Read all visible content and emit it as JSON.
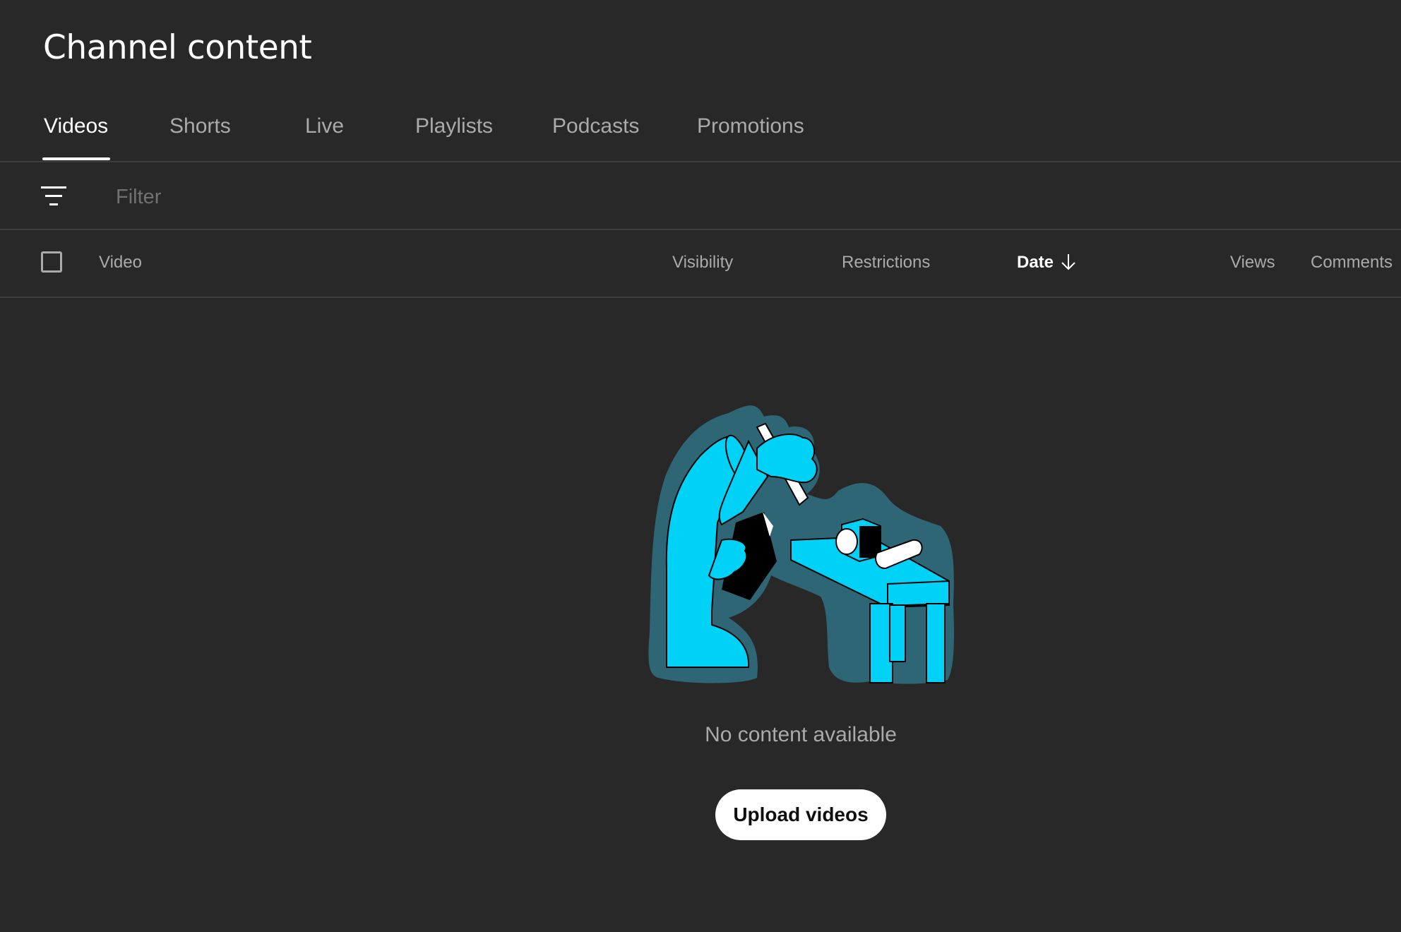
{
  "page": {
    "title": "Channel content"
  },
  "tabs": [
    {
      "label": "Videos",
      "active": true
    },
    {
      "label": "Shorts",
      "active": false
    },
    {
      "label": "Live",
      "active": false
    },
    {
      "label": "Playlists",
      "active": false
    },
    {
      "label": "Podcasts",
      "active": false
    },
    {
      "label": "Promotions",
      "active": false
    }
  ],
  "filter": {
    "placeholder": "Filter",
    "value": "",
    "icon": "filter-lines-icon"
  },
  "table": {
    "columns": [
      {
        "label": "Video"
      },
      {
        "label": "Visibility"
      },
      {
        "label": "Restrictions"
      },
      {
        "label": "Date",
        "sorted": "descending",
        "icon": "arrow-down-icon"
      },
      {
        "label": "Views"
      },
      {
        "label": "Comments"
      }
    ]
  },
  "empty_state": {
    "illustration": "person-examining-camera-illustration",
    "message": "No content available",
    "button_label": "Upload videos"
  },
  "colors": {
    "background": "#282828",
    "illustration_primary": "#00d1f7",
    "illustration_halo": "#2e6675",
    "text_secondary": "#aaaaaa"
  }
}
